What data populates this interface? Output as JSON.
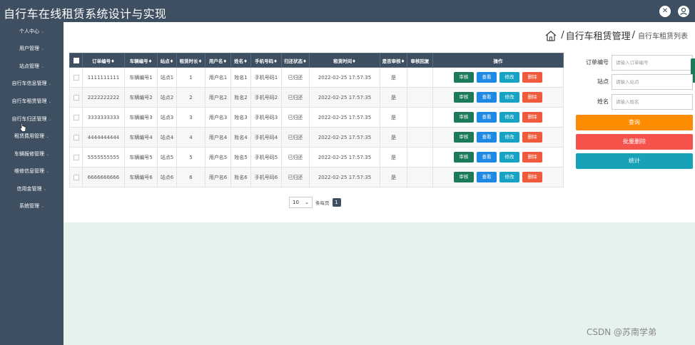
{
  "app": {
    "title": "自行车在线租赁系统设计与实现"
  },
  "header_icons": [
    "settings-icon",
    "user-icon"
  ],
  "sidebar": {
    "items": [
      {
        "label": "个人中心"
      },
      {
        "label": "用户管理"
      },
      {
        "label": "站点管理"
      },
      {
        "label": "自行车信息管理"
      },
      {
        "label": "自行车租赁管理"
      },
      {
        "label": "自行车归还管理"
      },
      {
        "label": "租赁费用管理"
      },
      {
        "label": "车辆报修管理"
      },
      {
        "label": "维修信息管理"
      },
      {
        "label": "信用金管理"
      },
      {
        "label": "系统管理"
      }
    ]
  },
  "breadcrumb": {
    "main": "自行车租赁管理",
    "separator": "/",
    "sub": "自行车租赁列表"
  },
  "table": {
    "headers": [
      "订单编号",
      "车辆编号",
      "站点",
      "租赁时长",
      "用户名",
      "姓名",
      "手机号码",
      "归还状态",
      "租赁时间",
      "是否审核",
      "审核回复",
      "操作"
    ],
    "sort_mark": "♦",
    "rows": [
      {
        "order_no": "1111111111",
        "vehicle_no": "车辆编号1",
        "station": "站点1",
        "duration": "1",
        "username": "用户名1",
        "name": "姓名1",
        "phone": "手机号码1",
        "return_status": "已归还",
        "rent_time": "2022-02-25 17:57:35",
        "audited": "是",
        "reply": ""
      },
      {
        "order_no": "2222222222",
        "vehicle_no": "车辆编号2",
        "station": "站点2",
        "duration": "2",
        "username": "用户名2",
        "name": "姓名2",
        "phone": "手机号码2",
        "return_status": "已归还",
        "rent_time": "2022-02-25 17:57:35",
        "audited": "是",
        "reply": ""
      },
      {
        "order_no": "3333333333",
        "vehicle_no": "车辆编号3",
        "station": "站点3",
        "duration": "3",
        "username": "用户名3",
        "name": "姓名3",
        "phone": "手机号码3",
        "return_status": "已归还",
        "rent_time": "2022-02-25 17:57:35",
        "audited": "是",
        "reply": ""
      },
      {
        "order_no": "4444444444",
        "vehicle_no": "车辆编号4",
        "station": "站点4",
        "duration": "4",
        "username": "用户名4",
        "name": "姓名4",
        "phone": "手机号码4",
        "return_status": "已归还",
        "rent_time": "2022-02-25 17:57:35",
        "audited": "是",
        "reply": ""
      },
      {
        "order_no": "5555555555",
        "vehicle_no": "车辆编号5",
        "station": "站点5",
        "duration": "5",
        "username": "用户名5",
        "name": "姓名5",
        "phone": "手机号码5",
        "return_status": "已归还",
        "rent_time": "2022-02-25 17:57:35",
        "audited": "是",
        "reply": ""
      },
      {
        "order_no": "6666666666",
        "vehicle_no": "车辆编号6",
        "station": "站点6",
        "duration": "6",
        "username": "用户名6",
        "name": "姓名6",
        "phone": "手机号码6",
        "return_status": "已归还",
        "rent_time": "2022-02-25 17:57:35",
        "audited": "是",
        "reply": ""
      }
    ],
    "actions": {
      "audit": "审核",
      "view": "查看",
      "edit": "修改",
      "delete": "删除"
    }
  },
  "pagination": {
    "page_size": "10",
    "per_page_label": "条每页",
    "current_page": "1"
  },
  "search": {
    "order_no_label": "订单编号",
    "order_no_placeholder": "请输入订单编号",
    "station_label": "站点",
    "station_placeholder": "请输入站点",
    "name_label": "姓名",
    "name_placeholder": "请输入姓名",
    "query_button": "查询",
    "batch_delete_button": "批量删除",
    "stats_button": "统计"
  },
  "watermark": "CSDN @苏南学弟",
  "colors": {
    "sidebar": "#3d4f60",
    "audit": "#1b7a5a",
    "view": "#1e88e5",
    "edit": "#17a2c4",
    "delete": "#f05a3c",
    "query": "#ff8c00",
    "batch_delete": "#f5524b",
    "stats": "#17a2b8"
  }
}
